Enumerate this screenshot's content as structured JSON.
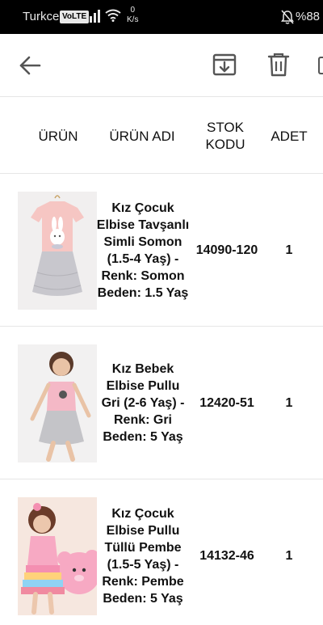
{
  "status_bar": {
    "carrier": "Turkcell",
    "volte": "VoLTE",
    "speed_value": "0",
    "speed_unit": "K/s",
    "battery": "%88"
  },
  "toolbar": {
    "back_icon": "arrow-left-icon",
    "archive_icon": "archive-download-icon",
    "delete_icon": "trash-icon"
  },
  "table": {
    "headers": {
      "product": "ÜRÜN",
      "name": "ÜRÜN ADI",
      "code": "STOK KODU",
      "qty": "ADET"
    },
    "rows": [
      {
        "name": "Kız Çocuk Elbise Tavşanlı Simli Somon (1.5-4 Yaş) - Renk: Somon Beden: 1.5 Yaş",
        "code": "14090-120",
        "qty": "1"
      },
      {
        "name": "Kız Bebek Elbise Pullu Gri (2-6 Yaş) - Renk: Gri Beden: 5 Yaş",
        "code": "12420-51",
        "qty": "1"
      },
      {
        "name": "Kız Çocuk Elbise Pullu Tüllü Pembe (1.5-5 Yaş) - Renk: Pembe Beden: 5 Yaş",
        "code": "14132-46",
        "qty": "1"
      }
    ]
  },
  "colors": {
    "status_bar_bg": "#000000",
    "divider": "#e6e6e6",
    "icon": "#555555"
  }
}
